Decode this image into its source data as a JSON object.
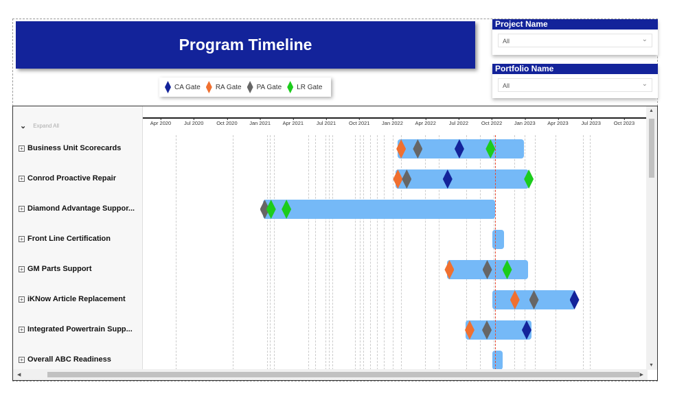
{
  "title": "Program Timeline",
  "legend": [
    {
      "label": "CA Gate",
      "color": "#13239a"
    },
    {
      "label": "RA Gate",
      "color": "#f07030"
    },
    {
      "label": "PA Gate",
      "color": "#666666"
    },
    {
      "label": "LR Gate",
      "color": "#1ccc1c"
    }
  ],
  "slicers": {
    "project": {
      "title": "Project Name",
      "value": "All"
    },
    "portfolio": {
      "title": "Portfolio Name",
      "value": "All"
    }
  },
  "expand_all": "Expand All",
  "axis_ticks": [
    "Apr 2020",
    "Jul 2020",
    "Oct 2020",
    "Jan 2021",
    "Apr 2021",
    "Jul 2021",
    "Oct 2021",
    "Jan 2022",
    "Apr 2022",
    "Jul 2022",
    "Oct 2022",
    "Jan 2023",
    "Apr 2023",
    "Jul 2023",
    "Oct 2023"
  ],
  "today": "2022-10-11",
  "bar_color": "#75b9f7",
  "rows": [
    {
      "name": "Business Unit Scorecards",
      "start": "2022-01-15",
      "end": "2022-12-28",
      "gates": [
        {
          "type": "RA",
          "date": "2022-01-25"
        },
        {
          "type": "PA",
          "date": "2022-03-10"
        },
        {
          "type": "CA",
          "date": "2022-07-03"
        },
        {
          "type": "LR",
          "date": "2022-09-28"
        }
      ]
    },
    {
      "name": "Conrod Proactive Repair",
      "start": "2022-01-09",
      "end": "2023-01-12",
      "gates": [
        {
          "type": "RA",
          "date": "2022-01-16"
        },
        {
          "type": "PA",
          "date": "2022-02-10"
        },
        {
          "type": "CA",
          "date": "2022-06-01"
        },
        {
          "type": "LR",
          "date": "2023-01-12"
        }
      ]
    },
    {
      "name": "Diamond Advantage Suppor...",
      "start": "2021-01-10",
      "end": "2022-10-10",
      "gates": [
        {
          "type": "PA",
          "date": "2021-01-14"
        },
        {
          "type": "LR",
          "date": "2021-02-01"
        },
        {
          "type": "LR",
          "date": "2021-03-13"
        }
      ]
    },
    {
      "name": "Front Line Certification",
      "start": "2022-10-02",
      "end": "2022-11-04",
      "gates": []
    },
    {
      "name": "GM Parts Support",
      "start": "2022-05-29",
      "end": "2023-01-09",
      "gates": [
        {
          "type": "RA",
          "date": "2022-06-06"
        },
        {
          "type": "PA",
          "date": "2022-09-19"
        },
        {
          "type": "LR",
          "date": "2022-11-13"
        }
      ]
    },
    {
      "name": "iKNow Article Replacement",
      "start": "2022-10-02",
      "end": "2023-05-19",
      "gates": [
        {
          "type": "RA",
          "date": "2022-12-04"
        },
        {
          "type": "PA",
          "date": "2023-01-26"
        },
        {
          "type": "CA",
          "date": "2023-05-16"
        }
      ]
    },
    {
      "name": "Integrated Powertrain Supp...",
      "start": "2022-07-21",
      "end": "2023-01-19",
      "gates": [
        {
          "type": "RA",
          "date": "2022-08-01"
        },
        {
          "type": "PA",
          "date": "2022-09-18"
        },
        {
          "type": "CA",
          "date": "2023-01-06"
        }
      ]
    },
    {
      "name": "Overall ABC Readiness",
      "start": "2022-10-02",
      "end": "2022-10-31",
      "gates": []
    }
  ]
}
